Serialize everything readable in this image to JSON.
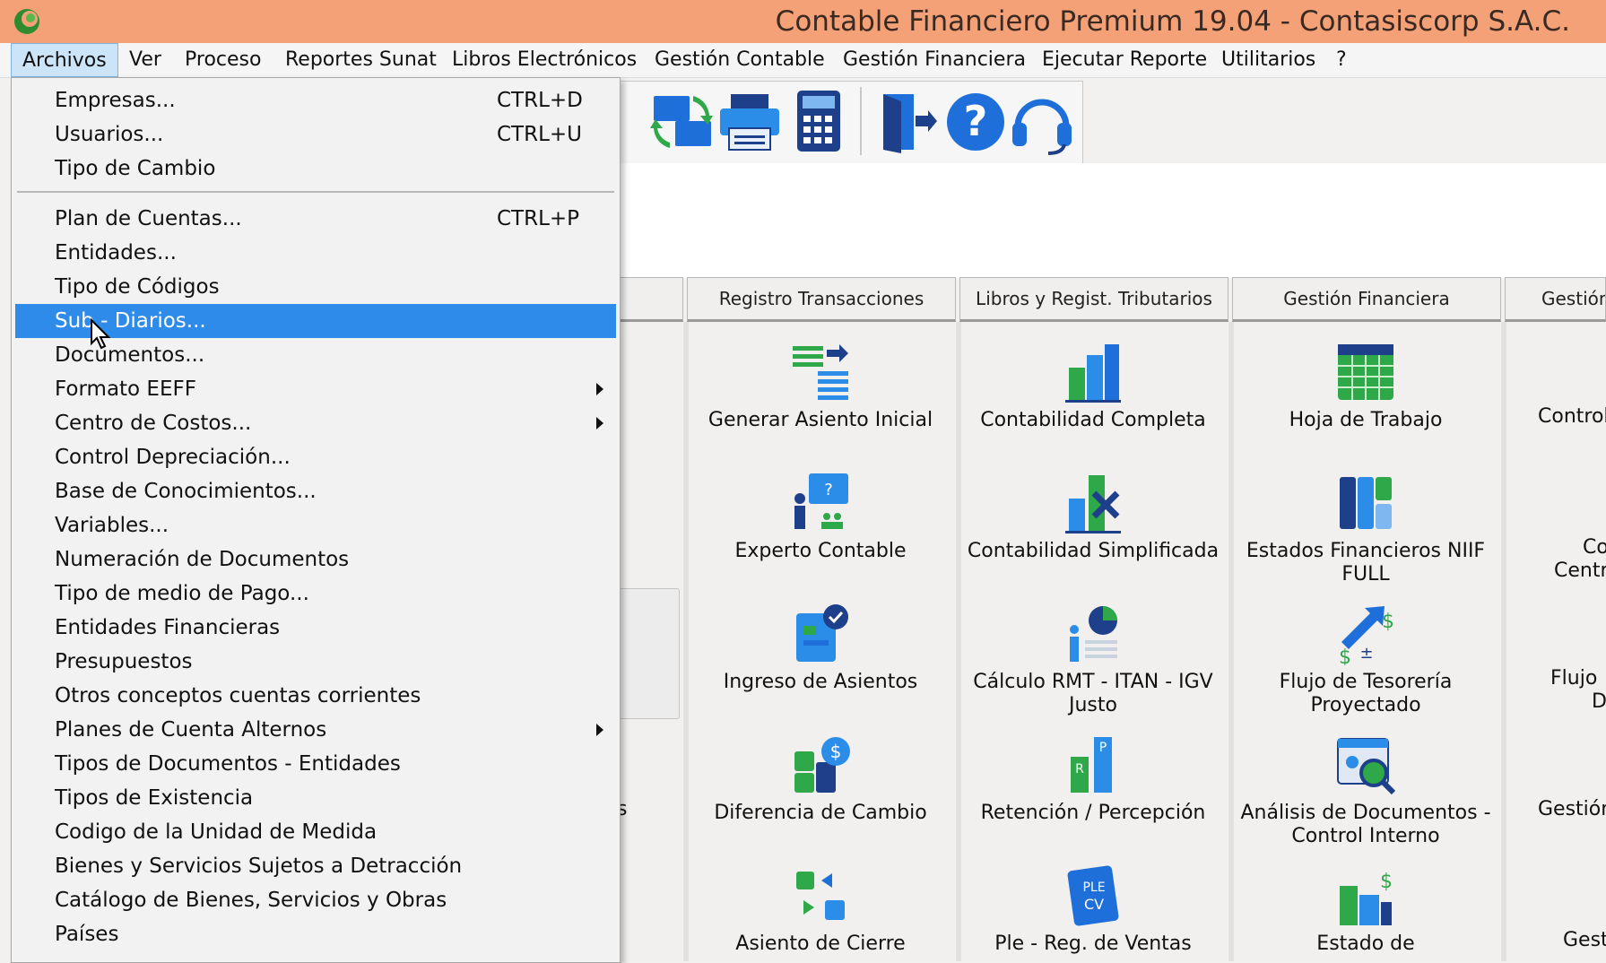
{
  "window": {
    "title": "Contable Financiero Premium 19.04 - Contasiscorp S.A.C."
  },
  "menubar": {
    "items": [
      "Archivos",
      "Ver",
      "Proceso",
      "Reportes Sunat",
      "Libros Electrónicos",
      "Gestión Contable",
      "Gestión Financiera",
      "Ejecutar Reporte",
      "Utilitarios",
      "?"
    ]
  },
  "dropdown": {
    "items": [
      {
        "label": "Empresas...",
        "shortcut": "CTRL+D"
      },
      {
        "label": "Usuarios...",
        "shortcut": "CTRL+U"
      },
      {
        "label": "Tipo de Cambio",
        "shortcut": ""
      },
      {
        "label": "Plan de Cuentas...",
        "shortcut": "CTRL+P"
      },
      {
        "label": "Entidades...",
        "shortcut": ""
      },
      {
        "label": "Tipo de Códigos",
        "shortcut": ""
      },
      {
        "label": "Sub - Diarios...",
        "shortcut": ""
      },
      {
        "label": "Documentos...",
        "shortcut": ""
      },
      {
        "label": "Formato EEFF",
        "shortcut": ""
      },
      {
        "label": "Centro de Costos...",
        "shortcut": ""
      },
      {
        "label": "Control Depreciación...",
        "shortcut": ""
      },
      {
        "label": "Base de Conocimientos...",
        "shortcut": ""
      },
      {
        "label": "Variables...",
        "shortcut": ""
      },
      {
        "label": "Numeración de Documentos",
        "shortcut": ""
      },
      {
        "label": "Tipo de medio de Pago...",
        "shortcut": ""
      },
      {
        "label": "Entidades Financieras",
        "shortcut": ""
      },
      {
        "label": "Presupuestos",
        "shortcut": ""
      },
      {
        "label": "Otros conceptos cuentas corrientes",
        "shortcut": ""
      },
      {
        "label": "Planes de Cuenta Alternos",
        "shortcut": ""
      },
      {
        "label": "Tipos de Documentos - Entidades",
        "shortcut": ""
      },
      {
        "label": "Tipos de Existencia",
        "shortcut": ""
      },
      {
        "label": "Codigo de la Unidad de Medida",
        "shortcut": ""
      },
      {
        "label": "Bienes y Servicios Sujetos a Detracción",
        "shortcut": ""
      },
      {
        "label": "Catálogo de Bienes, Servicios y Obras",
        "shortcut": ""
      },
      {
        "label": "Países",
        "shortcut": ""
      }
    ]
  },
  "tabs": [
    "Registro Transacciones",
    "Libros y Regist. Tributarios",
    "Gestión Financiera",
    "Gestión"
  ],
  "columns": {
    "registro": [
      "Generar Asiento Inicial",
      "Experto Contable",
      "Ingreso de Asientos",
      "Diferencia de Cambio",
      "Asiento de Cierre"
    ],
    "libros": [
      "Contabilidad Completa",
      "Contabilidad Simplificada",
      "Cálculo RMT - ITAN - IGV Justo",
      "Retención / Percepción",
      "Ple - Reg. de Ventas"
    ],
    "financiera": [
      "Hoja de Trabajo",
      "Estados Financieros NIIF FULL",
      "Flujo de Tesorería Proyectado",
      "Análisis de Documentos - Control Interno",
      "Estado de"
    ],
    "gestion_partial": [
      "Control",
      "Co",
      "Centr",
      "Flujo",
      "D",
      "Gestión",
      "Gest"
    ],
    "left_partial": "s"
  },
  "colors": {
    "titlebar": "#f4a178",
    "menu_active": "#cce4f7",
    "selection": "#2f8bea"
  }
}
